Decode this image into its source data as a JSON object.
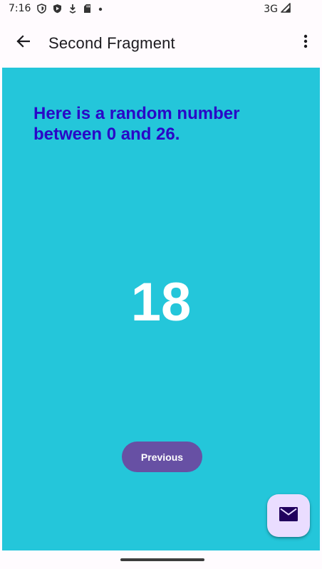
{
  "status_bar": {
    "time": "7:16",
    "network": "3G",
    "icons": [
      "shield-icon",
      "play-protect-icon",
      "download-icon",
      "sd-card-icon",
      "notification-dot-icon",
      "signal-icon"
    ]
  },
  "app_bar": {
    "title": "Second Fragment",
    "back_icon": "arrow-back-icon",
    "overflow_icon": "more-vert-icon"
  },
  "content": {
    "headline": "Here is a random number between 0 and 26.",
    "random_number": "18",
    "previous_label": "Previous",
    "fab_icon": "email-icon",
    "background_color": "#24c6da",
    "headline_color": "#2a06c7",
    "button_color": "#6750a4",
    "fab_color": "#eaddff"
  }
}
